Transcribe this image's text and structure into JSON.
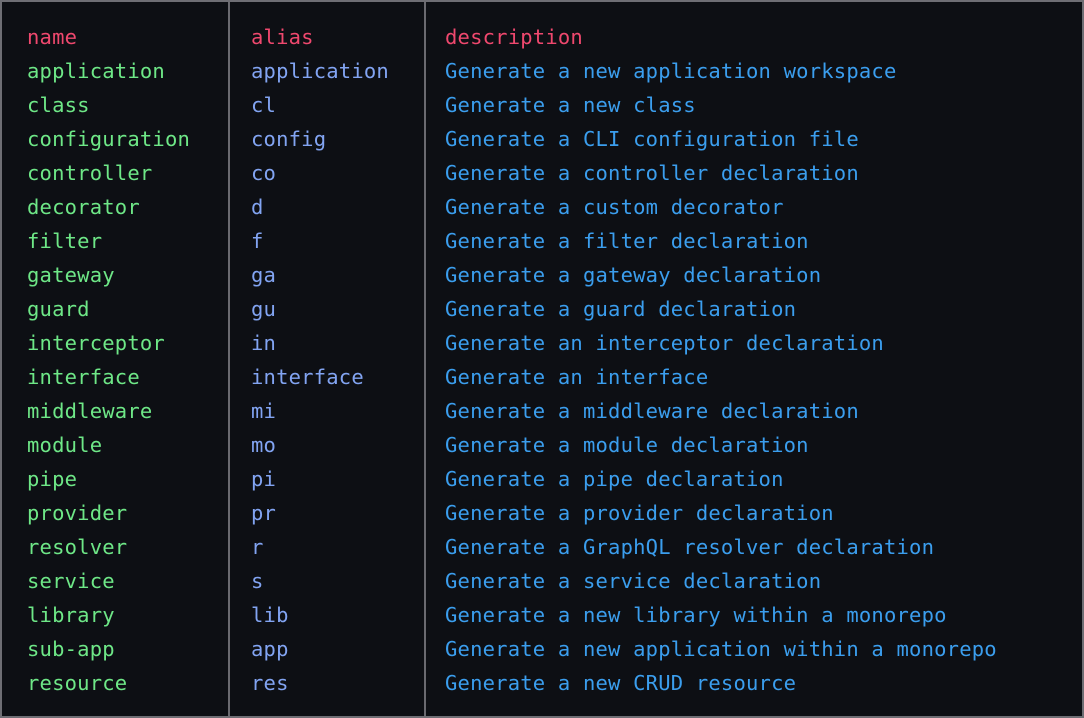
{
  "terminal": {
    "frame_border_color": "#6e6e74",
    "background_color": "#0d0f14",
    "divider_color": "#6a6a70"
  },
  "table": {
    "colors": {
      "header": "#ef486e",
      "name": "#6ee787",
      "alias": "#82a4f2",
      "description": "#3b9eee"
    },
    "columns": [
      {
        "key": "name",
        "header": "name"
      },
      {
        "key": "alias",
        "header": "alias"
      },
      {
        "key": "description",
        "header": "description"
      }
    ],
    "rows": [
      {
        "name": "application",
        "alias": "application",
        "description": "Generate a new application workspace"
      },
      {
        "name": "class",
        "alias": "cl",
        "description": "Generate a new class"
      },
      {
        "name": "configuration",
        "alias": "config",
        "description": "Generate a CLI configuration file"
      },
      {
        "name": "controller",
        "alias": "co",
        "description": "Generate a controller declaration"
      },
      {
        "name": "decorator",
        "alias": "d",
        "description": "Generate a custom decorator"
      },
      {
        "name": "filter",
        "alias": "f",
        "description": "Generate a filter declaration"
      },
      {
        "name": "gateway",
        "alias": "ga",
        "description": "Generate a gateway declaration"
      },
      {
        "name": "guard",
        "alias": "gu",
        "description": "Generate a guard declaration"
      },
      {
        "name": "interceptor",
        "alias": "in",
        "description": "Generate an interceptor declaration"
      },
      {
        "name": "interface",
        "alias": "interface",
        "description": "Generate an interface"
      },
      {
        "name": "middleware",
        "alias": "mi",
        "description": "Generate a middleware declaration"
      },
      {
        "name": "module",
        "alias": "mo",
        "description": "Generate a module declaration"
      },
      {
        "name": "pipe",
        "alias": "pi",
        "description": "Generate a pipe declaration"
      },
      {
        "name": "provider",
        "alias": "pr",
        "description": "Generate a provider declaration"
      },
      {
        "name": "resolver",
        "alias": "r",
        "description": "Generate a GraphQL resolver declaration"
      },
      {
        "name": "service",
        "alias": "s",
        "description": "Generate a service declaration"
      },
      {
        "name": "library",
        "alias": "lib",
        "description": "Generate a new library within a monorepo"
      },
      {
        "name": "sub-app",
        "alias": "app",
        "description": "Generate a new application within a monorepo"
      },
      {
        "name": "resource",
        "alias": "res",
        "description": "Generate a new CRUD resource"
      }
    ]
  }
}
